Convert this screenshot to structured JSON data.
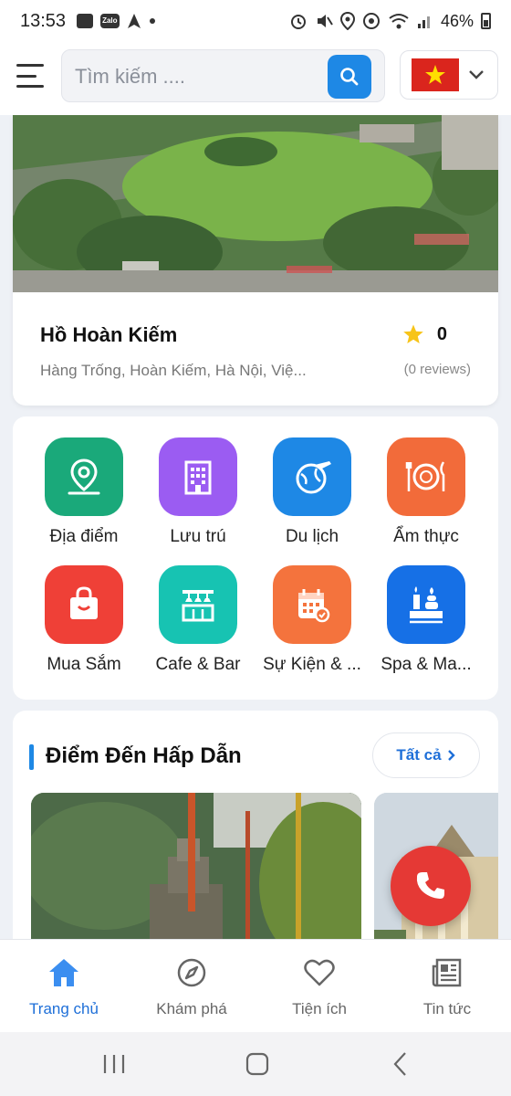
{
  "status_bar": {
    "time": "13:53",
    "battery": "46%",
    "zalo_label": "Zalo"
  },
  "header": {
    "search_placeholder": "Tìm kiếm ....",
    "language_flag": "vietnam-flag-icon"
  },
  "hero": {
    "title": "Hồ Hoàn Kiếm",
    "address": "Hàng Trống, Hoàn Kiếm, Hà Nội, Việ...",
    "rating": "0",
    "reviews": "(0 reviews)"
  },
  "categories": [
    {
      "label": "Địa điểm",
      "icon": "location-pin-icon",
      "color": "#1aa97a"
    },
    {
      "label": "Lưu trú",
      "icon": "hotel-building-icon",
      "color": "#9b5cf2"
    },
    {
      "label": "Du lịch",
      "icon": "globe-plane-icon",
      "color": "#1e88e5"
    },
    {
      "label": "Ẩm thực",
      "icon": "dining-plate-icon",
      "color": "#f26b3a"
    },
    {
      "label": "Mua Sắm",
      "icon": "shopping-bag-icon",
      "color": "#ef4037"
    },
    {
      "label": "Cafe & Bar",
      "icon": "cafe-shop-icon",
      "color": "#17c3b2"
    },
    {
      "label": "Sự Kiện & ...",
      "icon": "calendar-event-icon",
      "color": "#f4733d"
    },
    {
      "label": "Spa & Ma...",
      "icon": "spa-candle-icon",
      "color": "#1670e6"
    }
  ],
  "featured": {
    "title": "Điểm Đến Hấp Dẫn",
    "see_all": "Tất cả"
  },
  "bottom_nav": [
    {
      "label": "Trang chủ",
      "icon": "home-icon",
      "active": true
    },
    {
      "label": "Khám phá",
      "icon": "compass-icon",
      "active": false
    },
    {
      "label": "Tiện ích",
      "icon": "heart-icon",
      "active": false
    },
    {
      "label": "Tin tức",
      "icon": "newspaper-icon",
      "active": false
    }
  ],
  "colors": {
    "accent": "#1e88e5",
    "active_nav": "#1e6fd8",
    "call_button": "#e53935",
    "star": "#f7c419"
  }
}
